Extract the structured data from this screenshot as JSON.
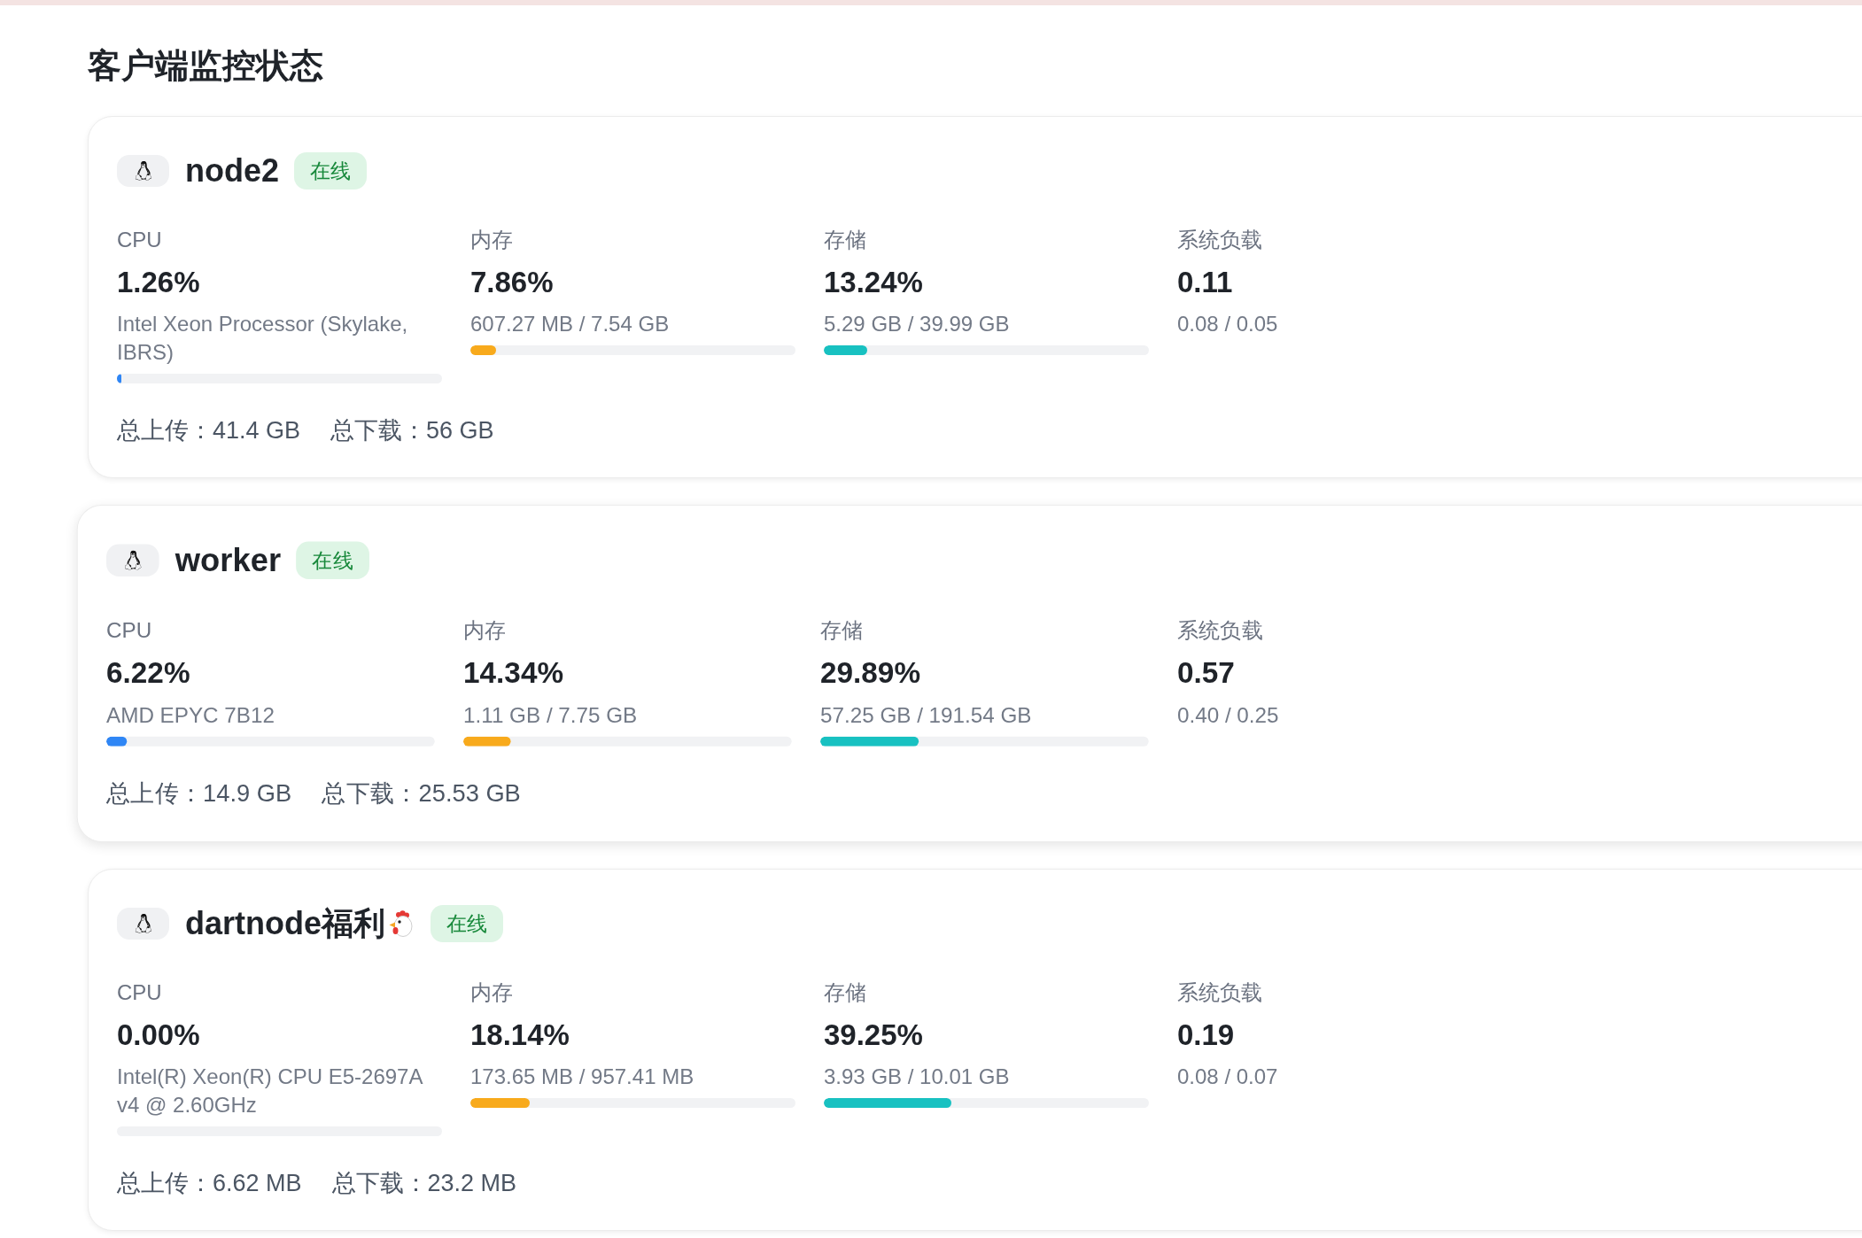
{
  "title": "客户端监控状态",
  "cards": [
    {
      "name": "node2",
      "name_emoji": false,
      "status": "在线",
      "online": true,
      "hovered": false,
      "metrics": [
        {
          "kind": "usage",
          "label": "CPU",
          "value": "1.26%",
          "detail": "Intel Xeon Processor (Skylake, IBRS)",
          "level": 0.0126,
          "color": "#2f86f5"
        },
        {
          "kind": "usage",
          "label": "内存",
          "value": "7.86%",
          "detail": "607.27 MB / 7.54 GB",
          "level": 0.0786,
          "color": "#f8aa1c"
        },
        {
          "kind": "usage",
          "label": "存储",
          "value": "13.24%",
          "detail": "5.29 GB / 39.99 GB",
          "level": 0.1324,
          "color": "#18c1c1"
        },
        {
          "kind": "load",
          "label": "系统负载",
          "value": "0.11",
          "detail": "0.08 / 0.05"
        }
      ],
      "traffic": [
        "总上传：41.4 GB",
        "总下载：56 GB"
      ]
    },
    {
      "name": "worker",
      "name_emoji": false,
      "status": "在线",
      "online": true,
      "hovered": true,
      "metrics": [
        {
          "kind": "usage",
          "label": "CPU",
          "value": "6.22%",
          "detail": "AMD EPYC 7B12",
          "level": 0.0622,
          "color": "#2f86f5"
        },
        {
          "kind": "usage",
          "label": "内存",
          "value": "14.34%",
          "detail": "1.11 GB / 7.75 GB",
          "level": 0.1434,
          "color": "#f8aa1c"
        },
        {
          "kind": "usage",
          "label": "存储",
          "value": "29.89%",
          "detail": "57.25 GB / 191.54 GB",
          "level": 0.2989,
          "color": "#18c1c1"
        },
        {
          "kind": "load",
          "label": "系统负载",
          "value": "0.57",
          "detail": "0.40 / 0.25"
        }
      ],
      "traffic": [
        "总上传：14.9 GB",
        "总下载：25.53 GB"
      ]
    },
    {
      "name": "dartnode福利",
      "name_emoji": true,
      "status": "在线",
      "online": true,
      "hovered": false,
      "metrics": [
        {
          "kind": "usage",
          "label": "CPU",
          "value": "0.00%",
          "detail": "Intel(R) Xeon(R) CPU E5-2697A v4 @ 2.60GHz",
          "level": 0
        },
        {
          "kind": "usage",
          "label": "内存",
          "value": "18.14%",
          "detail": "173.65 MB / 957.41 MB",
          "level": 0.1814,
          "color": "#f8aa1c"
        },
        {
          "kind": "usage",
          "label": "存储",
          "value": "39.25%",
          "detail": "3.93 GB / 10.01 GB",
          "level": 0.3925,
          "color": "#18c1c1"
        },
        {
          "kind": "load",
          "label": "系统负载",
          "value": "0.19",
          "detail": "0.08 / 0.07"
        }
      ],
      "traffic": [
        "总上传：6.62 MB",
        "总下载：23.2 MB"
      ]
    }
  ]
}
